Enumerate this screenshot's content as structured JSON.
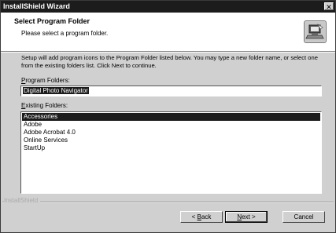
{
  "window": {
    "title": "InstallShield Wizard",
    "close_glyph": "✕"
  },
  "header": {
    "title": "Select Program Folder",
    "subtitle": "Please select a program folder.",
    "icon": "setup-computer-icon"
  },
  "description": "Setup will add program icons to the Program Folder listed below.  You may type a new folder name, or select one from the existing folders list.  Click Next to continue.",
  "program_folder": {
    "label_prefix": "P",
    "label_rest": "rogram Folders:",
    "value": "Digital Photo Navigator"
  },
  "existing_folders": {
    "label_prefix": "E",
    "label_rest": "xisting Folders:",
    "items": [
      "Accessories",
      "Adobe",
      "Adobe Acrobat 4.0",
      "Online Services",
      "StartUp"
    ],
    "selected": "Accessories"
  },
  "brand": "InstallShield",
  "buttons": {
    "back_prefix": "< ",
    "back_hot": "B",
    "back_rest": "ack",
    "next_hot": "N",
    "next_rest": "ext >",
    "cancel": "Cancel"
  }
}
